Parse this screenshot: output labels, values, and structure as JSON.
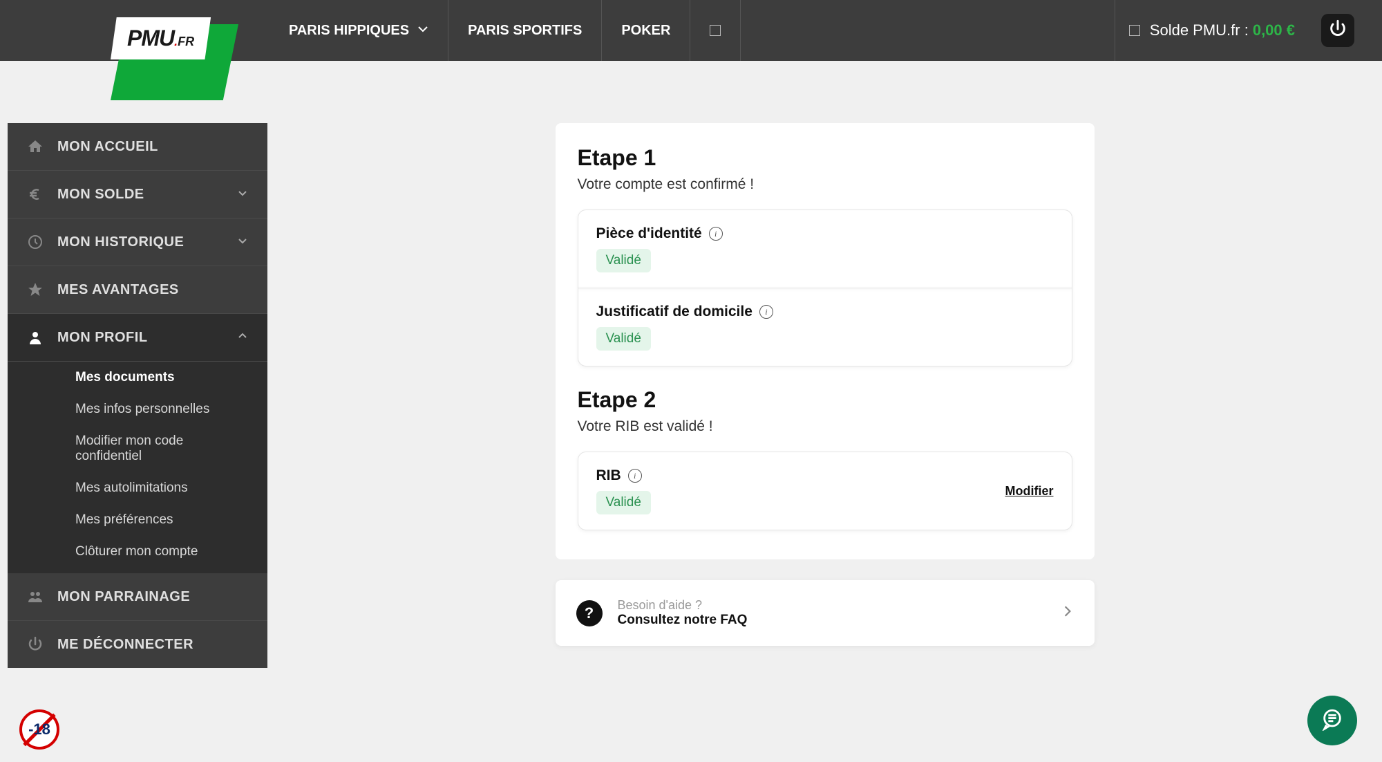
{
  "logo": {
    "main": "PMU",
    "suffix": ".FR"
  },
  "topnav": {
    "items": [
      "PARIS HIPPIQUES",
      "PARIS SPORTIFS",
      "POKER"
    ]
  },
  "balance": {
    "label": "Solde PMU.fr :",
    "amount": "0,00 €"
  },
  "sidebar": {
    "items": [
      {
        "label": "MON ACCUEIL",
        "icon": "home",
        "expandable": false
      },
      {
        "label": "MON SOLDE",
        "icon": "euro",
        "expandable": true
      },
      {
        "label": "MON HISTORIQUE",
        "icon": "clock",
        "expandable": true
      },
      {
        "label": "MES AVANTAGES",
        "icon": "star",
        "expandable": false
      },
      {
        "label": "MON PROFIL",
        "icon": "user",
        "expandable": true,
        "expanded": true,
        "children": [
          "Mes documents",
          "Mes infos personnelles",
          "Modifier mon code confidentiel",
          "Mes autolimitations",
          "Mes préférences",
          "Clôturer mon compte"
        ]
      },
      {
        "label": "MON PARRAINAGE",
        "icon": "users",
        "expandable": false
      },
      {
        "label": "ME DÉCONNECTER",
        "icon": "power",
        "expandable": false
      }
    ]
  },
  "main": {
    "step1": {
      "title": "Etape 1",
      "subtitle": "Votre compte est confirmé !",
      "docs": [
        {
          "title": "Pièce d'identité",
          "status": "Validé"
        },
        {
          "title": "Justificatif de domicile",
          "status": "Validé"
        }
      ]
    },
    "step2": {
      "title": "Etape 2",
      "subtitle": "Votre RIB est validé !",
      "doc": {
        "title": "RIB",
        "status": "Validé",
        "modify": "Modifier"
      }
    }
  },
  "faq": {
    "line1": "Besoin d'aide ?",
    "line2": "Consultez notre FAQ"
  },
  "age_badge": "-18"
}
